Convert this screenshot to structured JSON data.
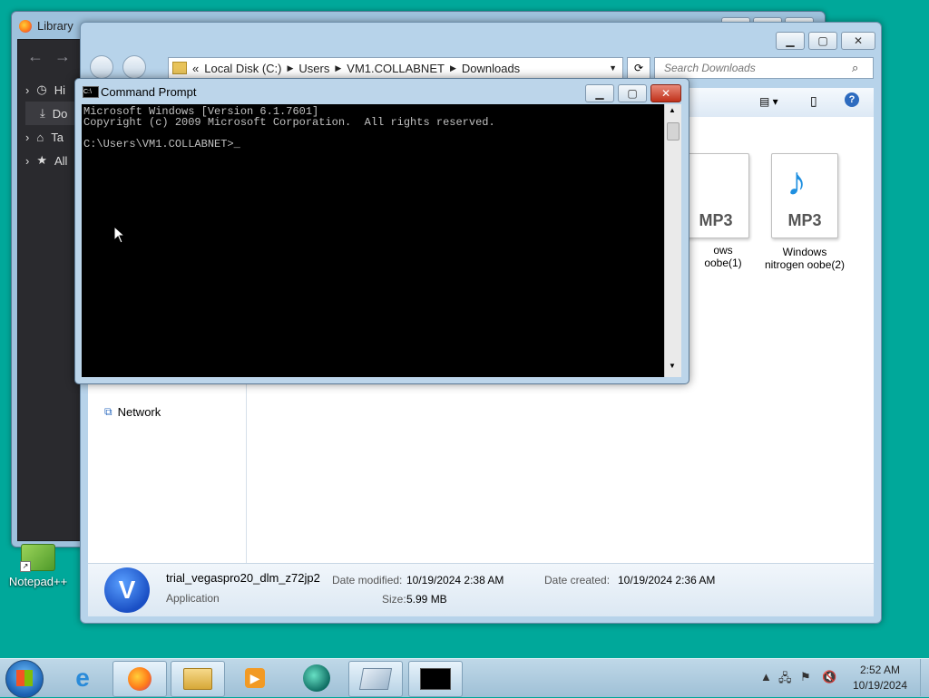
{
  "library": {
    "title": "Library",
    "nav_items": [
      "Hi",
      "Do",
      "Ta",
      "All"
    ]
  },
  "explorer": {
    "breadcrumb": [
      "Local Disk (C:)",
      "Users",
      "VM1.COLLABNET",
      "Downloads"
    ],
    "search_placeholder": "Search Downloads",
    "nav_network": "Network",
    "files": [
      {
        "name_lines": [
          "ows",
          "oobe(1)"
        ],
        "type": "MP3"
      },
      {
        "name_lines": [
          "Windows",
          "nitrogen oobe(2)"
        ],
        "type": "MP3"
      }
    ],
    "details": {
      "filename": "trial_vegaspro20_dlm_z72jp2",
      "kind": "Application",
      "modified_label": "Date modified:",
      "modified": "10/19/2024 2:38 AM",
      "size_label": "Size:",
      "size": "5.99 MB",
      "created_label": "Date created:",
      "created": "10/19/2024 2:36 AM"
    }
  },
  "cmd": {
    "title": "Command Prompt",
    "lines": [
      "Microsoft Windows [Version 6.1.7601]",
      "Copyright (c) 2009 Microsoft Corporation.  All rights reserved.",
      "",
      "C:\\Users\\VM1.COLLABNET>_"
    ]
  },
  "desktop": {
    "notepad_label": "Notepad++"
  },
  "taskbar": {
    "time": "2:52 AM",
    "date": "10/19/2024"
  }
}
